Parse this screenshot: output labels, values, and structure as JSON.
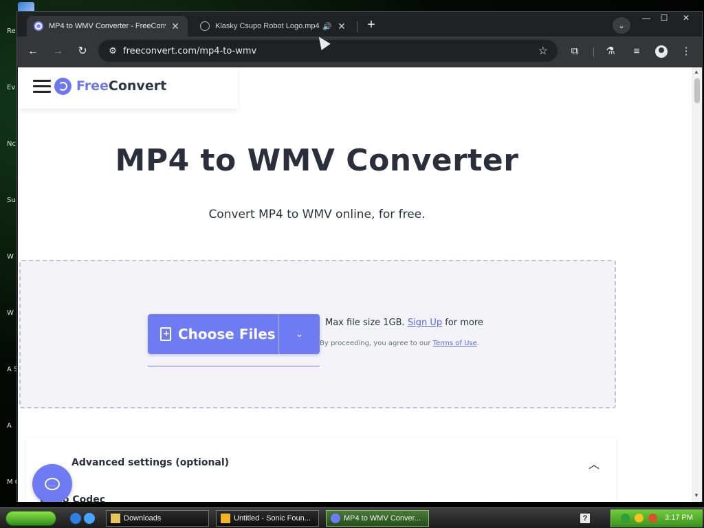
{
  "desktop": {
    "labels": [
      "Re",
      "Ev",
      "Nc",
      "Su",
      "W",
      "W",
      "A S",
      "A",
      "M O"
    ]
  },
  "browser": {
    "tabs": [
      {
        "title": "MP4 to WMV Converter - FreeConv",
        "close": "✕"
      },
      {
        "title": "Klasky Csupo Robot Logo.mp4",
        "speaker": "🔊",
        "close": "✕"
      }
    ],
    "new_tab": "+",
    "tab_search": "⌄",
    "window_controls": {
      "minimize": "—",
      "maximize": "☐",
      "close": "✕"
    },
    "nav": {
      "back": "←",
      "forward": "→",
      "reload": "↻"
    },
    "address": {
      "url": "freeconvert.com/mp4-to-wmv",
      "tune_icon": "⚙",
      "star": "☆"
    },
    "toolbar_icons": {
      "extensions": "⧉",
      "labs": "⚗",
      "media": "≡",
      "menu": "⋮"
    }
  },
  "page": {
    "logo": {
      "part1": "Free",
      "part2": "Convert"
    },
    "title": "MP4 to WMV Converter",
    "subtitle": "Convert MP4 to WMV online, for free.",
    "upload": {
      "button_label": "Choose Files",
      "caret": "⌄",
      "max_prefix": "Max file size 1GB.",
      "signup": "Sign Up",
      "max_suffix": "for more",
      "terms_prefix": "By proceeding, you agree to our",
      "terms_link": "Terms of Use",
      "terms_suffix": "."
    },
    "advanced": {
      "title": "Advanced settings (optional)",
      "caret": "︿",
      "video_codec": "Video Codec"
    },
    "chat_icon": "..."
  },
  "taskbar": {
    "tasks": [
      {
        "label": "Downloads"
      },
      {
        "label": "Untitled - Sonic Foun..."
      },
      {
        "label": "MP4 to WMV Conver..."
      }
    ],
    "help": "?",
    "clock": "3:17 PM"
  },
  "colors": {
    "accent": "#6f7bf3",
    "title_text": "#2a2f3b",
    "chrome_dark": "#202124",
    "chrome_toolbar": "#35363a"
  }
}
